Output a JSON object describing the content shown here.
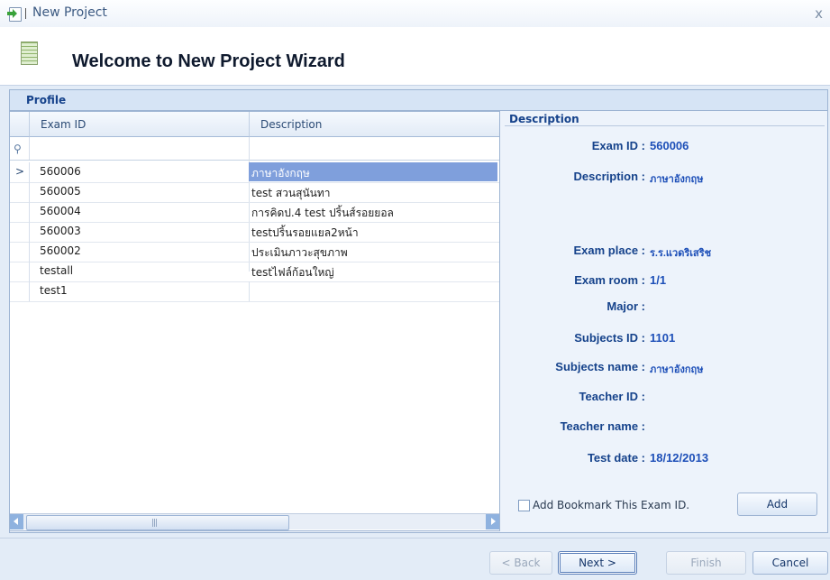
{
  "window": {
    "title": "New Project",
    "close_glyph": "x",
    "icon": "new-project-icon"
  },
  "header": {
    "title": "Welcome to New Project  Wizard",
    "icon": "project-sheet-icon"
  },
  "profile": {
    "label": "Profile"
  },
  "grid": {
    "columns": [
      "Exam ID",
      "Description"
    ],
    "filter_icon": "filter-icon",
    "row_indicator": ">",
    "selected_index": 0,
    "rows": [
      {
        "exam_id": "560006",
        "description": "ภาษาอังกฤษ"
      },
      {
        "exam_id": "560005",
        "description": "test สวนสุนันทา"
      },
      {
        "exam_id": "560004",
        "description": "การคิดป.4 test ปริ้นส์รอยยอล"
      },
      {
        "exam_id": "560003",
        "description": "testปริ้นรอยแยล2หน้า"
      },
      {
        "exam_id": "560002",
        "description": "ประเมินภาวะสุขภาพ"
      },
      {
        "exam_id": "testall",
        "description": "testไฟล์ก้อนใหญ่"
      },
      {
        "exam_id": "test1",
        "description": ""
      }
    ],
    "scroll_grip": "|||"
  },
  "detail": {
    "title": "Description",
    "fields": {
      "exam_id": {
        "label": "Exam ID :",
        "value": "560006"
      },
      "description": {
        "label": "Description :",
        "value": "ภาษาอังกฤษ"
      },
      "exam_place": {
        "label": "Exam place :",
        "value": "ร.ร.แวดริเสริช"
      },
      "exam_room": {
        "label": "Exam room :",
        "value": "1/1"
      },
      "major": {
        "label": "Major :",
        "value": ""
      },
      "subjects_id": {
        "label": "Subjects ID :",
        "value": "1101"
      },
      "subjects_name": {
        "label": "Subjects name :",
        "value": "ภาษาอังกฤษ"
      },
      "teacher_id": {
        "label": "Teacher ID :",
        "value": ""
      },
      "teacher_name": {
        "label": "Teacher name :",
        "value": ""
      },
      "test_date": {
        "label": "Test date :",
        "value": "18/12/2013"
      }
    },
    "bookmark_label": "Add Bookmark This Exam ID.",
    "bookmark_checked": false,
    "add_label": "Add"
  },
  "footer": {
    "back_label": "< Back",
    "next_label": "Next >",
    "finish_label": "Finish",
    "cancel_label": "Cancel"
  },
  "colors": {
    "selection": "#7f9fdc",
    "label_blue": "#15428b",
    "value_blue": "#1d4fb8"
  }
}
